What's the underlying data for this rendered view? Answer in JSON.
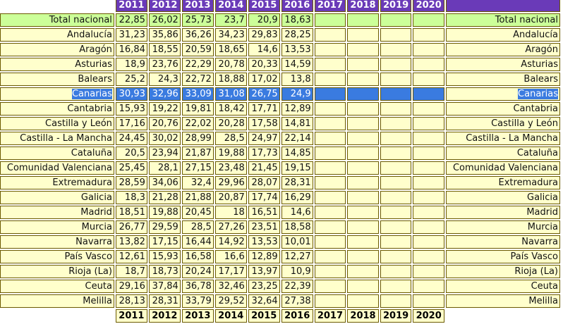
{
  "years": [
    "2011",
    "2012",
    "2013",
    "2014",
    "2015",
    "2016",
    "2017",
    "2018",
    "2019",
    "2020"
  ],
  "rows": [
    {
      "name": "Total nacional",
      "values": [
        "22,85",
        "26,02",
        "25,73",
        "23,7",
        "20,9",
        "18,63"
      ],
      "kind": "total"
    },
    {
      "name": "Andalucía",
      "values": [
        "31,23",
        "35,86",
        "36,26",
        "34,23",
        "29,83",
        "28,25"
      ]
    },
    {
      "name": "Aragón",
      "values": [
        "16,84",
        "18,55",
        "20,59",
        "18,65",
        "14,6",
        "13,53"
      ]
    },
    {
      "name": "Asturias",
      "values": [
        "18,9",
        "23,76",
        "22,29",
        "20,78",
        "20,33",
        "14,59"
      ]
    },
    {
      "name": "Balears",
      "values": [
        "25,2",
        "24,3",
        "22,72",
        "18,88",
        "17,02",
        "13,8"
      ]
    },
    {
      "name": "Canarias",
      "values": [
        "30,93",
        "32,96",
        "33,09",
        "31,08",
        "26,75",
        "24,9"
      ],
      "kind": "sel"
    },
    {
      "name": "Cantabria",
      "values": [
        "15,93",
        "19,22",
        "19,81",
        "18,42",
        "17,71",
        "12,89"
      ]
    },
    {
      "name": "Castilla y León",
      "values": [
        "17,16",
        "20,76",
        "22,02",
        "20,28",
        "17,58",
        "14,81"
      ]
    },
    {
      "name": "Castilla - La Mancha",
      "values": [
        "24,45",
        "30,02",
        "28,99",
        "28,5",
        "24,97",
        "22,14"
      ]
    },
    {
      "name": "Cataluña",
      "values": [
        "20,5",
        "23,94",
        "21,87",
        "19,88",
        "17,73",
        "14,85"
      ]
    },
    {
      "name": "Comunidad Valenciana",
      "values": [
        "25,45",
        "28,1",
        "27,15",
        "23,48",
        "21,45",
        "19,15"
      ]
    },
    {
      "name": "Extremadura",
      "values": [
        "28,59",
        "34,06",
        "32,4",
        "29,96",
        "28,07",
        "28,31"
      ]
    },
    {
      "name": "Galicia",
      "values": [
        "18,3",
        "21,28",
        "21,88",
        "20,87",
        "17,74",
        "16,29"
      ]
    },
    {
      "name": "Madrid",
      "values": [
        "18,51",
        "19,88",
        "20,45",
        "18",
        "16,51",
        "14,6"
      ]
    },
    {
      "name": "Murcia",
      "values": [
        "26,77",
        "29,59",
        "28,5",
        "27,26",
        "23,51",
        "18,58"
      ]
    },
    {
      "name": "Navarra",
      "values": [
        "13,82",
        "17,15",
        "16,44",
        "14,92",
        "13,53",
        "10,01"
      ]
    },
    {
      "name": "País Vasco",
      "values": [
        "12,61",
        "15,93",
        "16,58",
        "16,6",
        "12,89",
        "12,27"
      ]
    },
    {
      "name": "Rioja (La)",
      "values": [
        "18,7",
        "18,73",
        "20,24",
        "17,17",
        "13,97",
        "10,9"
      ]
    },
    {
      "name": "Ceuta",
      "values": [
        "29,16",
        "37,84",
        "36,78",
        "32,46",
        "23,25",
        "22,39"
      ]
    },
    {
      "name": "Melilla",
      "values": [
        "28,13",
        "28,31",
        "33,79",
        "29,52",
        "32,64",
        "27,38"
      ]
    }
  ]
}
